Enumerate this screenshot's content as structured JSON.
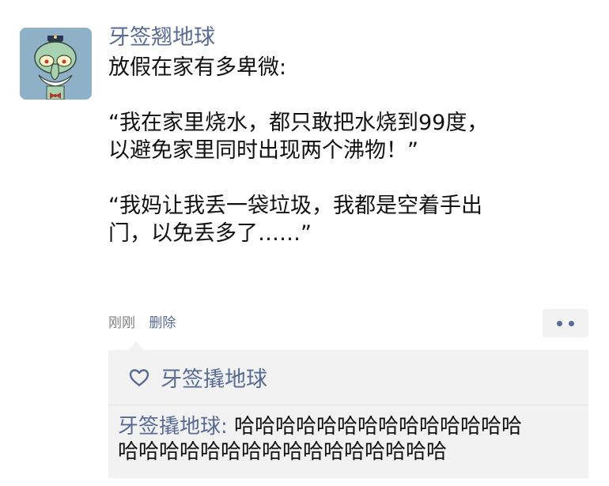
{
  "post": {
    "author": "牙签翘地球",
    "text_lines": [
      "放假在家有多卑微:",
      "",
      "“我在家里烧水，都只敢把水烧到99度，",
      "以避免家里同时出现两个沸物！”",
      "",
      "“我妈让我丢一袋垃圾，我都是空着手出",
      "门，以免丢多了……”"
    ],
    "time": "刚刚",
    "delete_label": "删除",
    "more_icon": "ellipsis-icon"
  },
  "interactions": {
    "like_icon": "heart-icon",
    "liker": "牙签撬地球",
    "comment": {
      "name": "牙签撬地球",
      "separator": ": ",
      "line1": "哈哈哈哈哈哈哈哈哈哈哈哈哈哈",
      "line2": "哈哈哈哈哈哈哈哈哈哈哈哈哈哈哈哈"
    }
  },
  "colors": {
    "link": "#576b95",
    "panel": "#f2f2f2",
    "text": "#111111",
    "meta": "#7f7f7f",
    "avatar_bg": "#8fb1c7"
  }
}
